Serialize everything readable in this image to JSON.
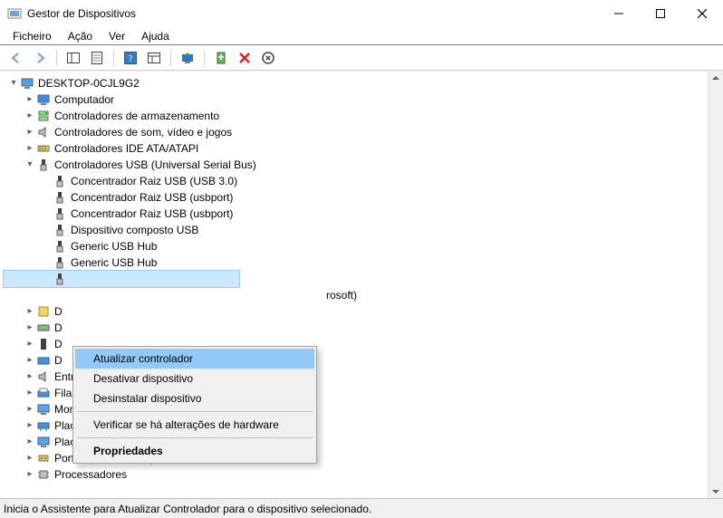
{
  "window": {
    "title": "Gestor de Dispositivos"
  },
  "menu": {
    "file": "Ficheiro",
    "action": "Ação",
    "view": "Ver",
    "help": "Ajuda"
  },
  "tree": {
    "root": "DESKTOP-0CJL9G2",
    "computer": "Computador",
    "storage_ctrl": "Controladores de armazenamento",
    "sound_ctrl": "Controladores de som, vídeo e jogos",
    "ide_ctrl": "Controladores IDE ATA/ATAPI",
    "usb_ctrl": "Controladores USB (Universal Serial Bus)",
    "usb": {
      "root_hub_30": "Concentrador Raiz USB (USB 3.0)",
      "root_hub_port1": "Concentrador Raiz USB (usbport)",
      "root_hub_port2": "Concentrador Raiz USB (usbport)",
      "composite": "Dispositivo composto USB",
      "generic_hub1": "Generic USB Hub",
      "generic_hub2": "Generic USB Hub",
      "behind_menu_tail": "rosoft)"
    },
    "partial": {
      "d1": "D",
      "d2": "D",
      "d3": "D",
      "d4": "D"
    },
    "audio_io": "Entradas e saídas de áudio",
    "print_queues": "Filas de impressão",
    "monitors": "Monitores",
    "net_adapters": "Placas de rede",
    "gfx_adapters": "Placas gráficas",
    "ports": "Portas (COM e LPT)",
    "processors": "Processadores"
  },
  "context_menu": {
    "update_driver": "Atualizar controlador",
    "disable_device": "Desativar dispositivo",
    "uninstall_device": "Desinstalar dispositivo",
    "scan_hardware": "Verificar se há alterações de hardware",
    "properties": "Propriedades"
  },
  "statusbar": {
    "text": "Inicia o Assistente para Atualizar Controlador para o dispositivo selecionado."
  }
}
